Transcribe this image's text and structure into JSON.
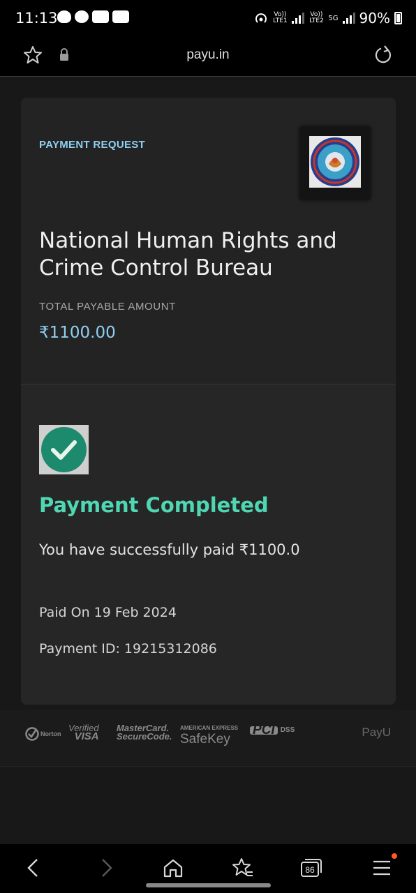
{
  "status_bar": {
    "time": "11:13",
    "notification_icons": [
      "snapchat-icon",
      "messages-icon",
      "paytm-icon",
      "wcf-icon"
    ],
    "lte1": "Vo)) LTE1",
    "lte2": "Vo)) LTE2",
    "network": "5G",
    "battery": "90%"
  },
  "url_bar": {
    "url": "payu.in",
    "icons": [
      "bookmark-star-icon",
      "lock-icon",
      "reload-icon"
    ]
  },
  "card": {
    "request_label": "PAYMENT REQUEST",
    "merchant_name": "National Human Rights and Crime Control Bureau",
    "total_label": "TOTAL PAYABLE AMOUNT",
    "amount": "₹1100.00",
    "status_title": "Payment Completed",
    "status_message": "You have successfully paid ₹1100.0",
    "paid_on": "Paid On 19 Feb 2024",
    "payment_id": "Payment ID: 19215312086",
    "colors": {
      "accent_blue": "#8fd0f2",
      "success_green": "#4fd6b2",
      "check_green": "#1e8a6d"
    }
  },
  "footer": {
    "norton": "Norton",
    "verified_by": "Verified",
    "visa": "VISA",
    "mastercard": "MasterCard.",
    "securecode": "SecureCode.",
    "amex": "AMERICAN EXPRESS",
    "safekey": "SafeKey",
    "pci": "PCI",
    "dss": "DSS",
    "payu": "PayU"
  },
  "bottom_nav": {
    "tab_count": "86",
    "icons": [
      "back-icon",
      "forward-icon",
      "home-icon",
      "bookmarks-icon",
      "tabs-icon",
      "menu-icon"
    ]
  }
}
